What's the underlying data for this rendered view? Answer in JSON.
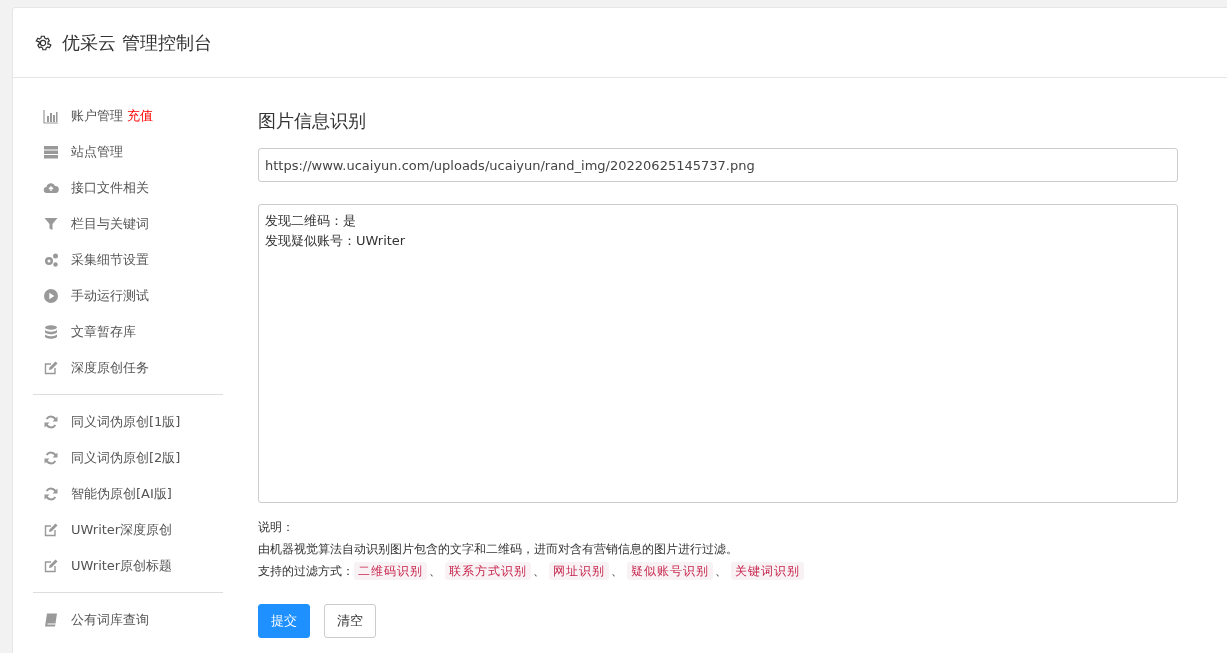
{
  "header": {
    "title": "优采云 管理控制台"
  },
  "sidebar": {
    "groups": [
      {
        "items": [
          {
            "label": "账户管理",
            "badge": "充值"
          },
          {
            "label": "站点管理"
          },
          {
            "label": "接口文件相关"
          },
          {
            "label": "栏目与关键词"
          },
          {
            "label": "采集细节设置"
          },
          {
            "label": "手动运行测试"
          },
          {
            "label": "文章暂存库"
          },
          {
            "label": "深度原创任务"
          }
        ]
      },
      {
        "items": [
          {
            "label": "同义词伪原创[1版]"
          },
          {
            "label": "同义词伪原创[2版]"
          },
          {
            "label": "智能伪原创[AI版]"
          },
          {
            "label": "UWriter深度原创"
          },
          {
            "label": "UWriter原创标题"
          }
        ]
      },
      {
        "items": [
          {
            "label": "公有词库查询"
          }
        ]
      }
    ]
  },
  "main": {
    "title": "图片信息识别",
    "url_field": {
      "value": "https://www.ucaiyun.com/uploads/ucaiyun/rand_img/20220625145737.png"
    },
    "result_box": {
      "lines": [
        "发现二维码：是",
        "发现疑似账号：UWriter"
      ]
    },
    "notes": {
      "heading": "说明：",
      "description": "由机器视觉算法自动识别图片包含的文字和二维码，进而对含有营销信息的图片进行过滤。",
      "methods_label": "支持的过滤方式：",
      "methods": [
        "二维码识别",
        "联系方式识别",
        "网址识别",
        "疑似账号识别",
        "关键词识别"
      ],
      "separator": "、"
    },
    "buttons": [
      {
        "label": "提交",
        "kind": "primary"
      },
      {
        "label": "清空",
        "kind": "default"
      }
    ]
  }
}
